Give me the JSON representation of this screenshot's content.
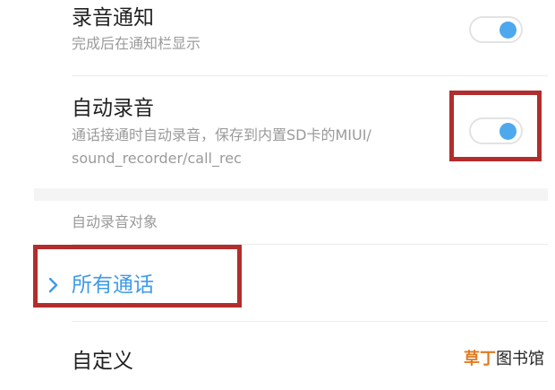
{
  "settings": {
    "recording_notification": {
      "title": "录音通知",
      "description": "完成后在通知栏显示",
      "enabled": true
    },
    "auto_record": {
      "title": "自动录音",
      "description_line1": "通话接通时自动录音，保存到内置SD卡的MIUI/",
      "description_line2": "sound_recorder/call_rec",
      "enabled": true
    }
  },
  "auto_record_target": {
    "header": "自动录音对象",
    "options": [
      {
        "label": "所有通话",
        "selected": true
      },
      {
        "label": "自定义",
        "selected": false
      }
    ]
  },
  "watermark": {
    "part1": "草丁",
    "part2": "图书馆"
  },
  "colors": {
    "accent": "#3d9be9",
    "toggle_knob": "#4ea8ee",
    "highlight_box": "#b22d2d",
    "watermark_accent": "#e07a1f"
  }
}
